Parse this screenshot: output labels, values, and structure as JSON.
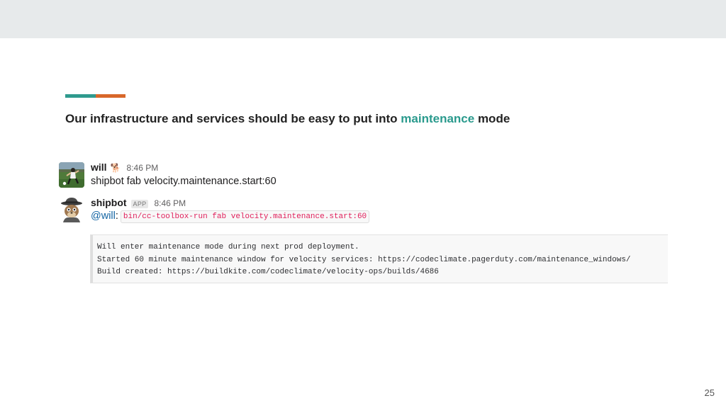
{
  "colors": {
    "top_band": "#e7eaeb",
    "accent_teal": "#2f9a8e",
    "accent_orange": "#d8672a",
    "highlight": "#2a9a8d",
    "inline_code": "#e01e5a"
  },
  "slide": {
    "title_before": "Our infrastructure and services should be easy to put into ",
    "title_highlight": "maintenance",
    "title_after": " mode",
    "page_number": "25"
  },
  "messages": [
    {
      "author": "will",
      "status_emoji": "🐕",
      "time": "8:46 PM",
      "text": "shipbot fab velocity.maintenance.start:60",
      "avatar_icon": "soccer-photo-avatar"
    },
    {
      "author": "shipbot",
      "badge": "APP",
      "time": "8:46 PM",
      "mention": "@will",
      "separator": ":",
      "command": "bin/cc-toolbox-run fab velocity.maintenance.start:60",
      "avatar_icon": "squirrel-fedora-avatar",
      "output_lines": [
        "Will enter maintenance mode during next prod deployment.",
        "Started 60 minute maintenance window for velocity services: https://codeclimate.pagerduty.com/maintenance_windows/",
        "Build created: https://buildkite.com/codeclimate/velocity-ops/builds/4686"
      ]
    }
  ]
}
